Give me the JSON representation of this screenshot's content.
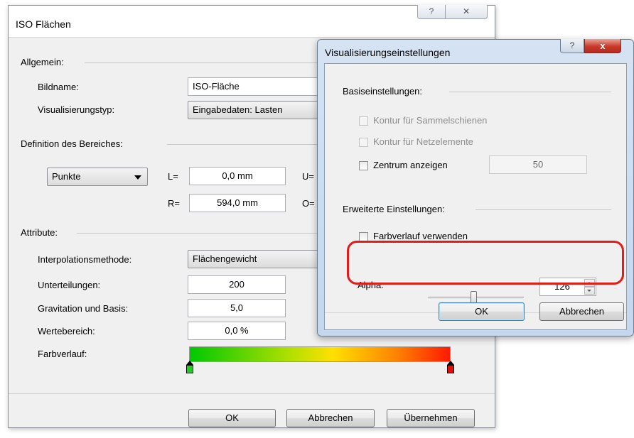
{
  "main": {
    "title": "ISO Flächen",
    "help_icon": "?",
    "close_icon": "✕",
    "allgemein": {
      "section_label": "Allgemein:",
      "bildname_label": "Bildname:",
      "bildname_value": "ISO-Fläche",
      "visualisierungstyp_label": "Visualisierungstyp:",
      "visualisierungstyp_value": "Eingabedaten: Lasten"
    },
    "bereich": {
      "section_label": "Definition des Bereiches:",
      "mode_value": "Punkte",
      "l_label": "L=",
      "l_value": "0,0 mm",
      "r_label": "R=",
      "r_value": "594,0 mm",
      "u_label": "U=",
      "o_label": "O="
    },
    "attribute": {
      "section_label": "Attribute:",
      "interpolation_label": "Interpolationsmethode:",
      "interpolation_value": "Flächengewicht",
      "unterteilungen_label": "Unterteilungen:",
      "unterteilungen_value": "200",
      "gravitation_label": "Gravitation und Basis:",
      "gravitation_value": "5,0",
      "wertebereich_label": "Wertebereich:",
      "wertebereich_value": "0,0 %",
      "farbverlauf_label": "Farbverlauf:"
    },
    "buttons": {
      "ok": "OK",
      "cancel": "Abbrechen",
      "apply": "Übernehmen"
    }
  },
  "vis": {
    "title": "Visualisierungseinstellungen",
    "help_icon": "?",
    "close_icon": "x",
    "basis": {
      "section_label": "Basiseinstellungen:",
      "kontur_sammelschienen": "Kontur für Sammelschienen",
      "kontur_netzelemente": "Kontur für Netzelemente",
      "zentrum_anzeigen": "Zentrum anzeigen",
      "zentrum_value": "50"
    },
    "erweitert": {
      "section_label": "Erweiterte Einstellungen:",
      "farbverlauf_verwenden": "Farbverlauf verwenden",
      "alpha_label": "Alpha:",
      "alpha_value": "126"
    },
    "buttons": {
      "ok": "OK",
      "cancel": "Abbrechen"
    }
  },
  "colors": {
    "highlight": "#e31b1b",
    "gradient_start": "#00c800",
    "gradient_end": "#ff1a00"
  }
}
